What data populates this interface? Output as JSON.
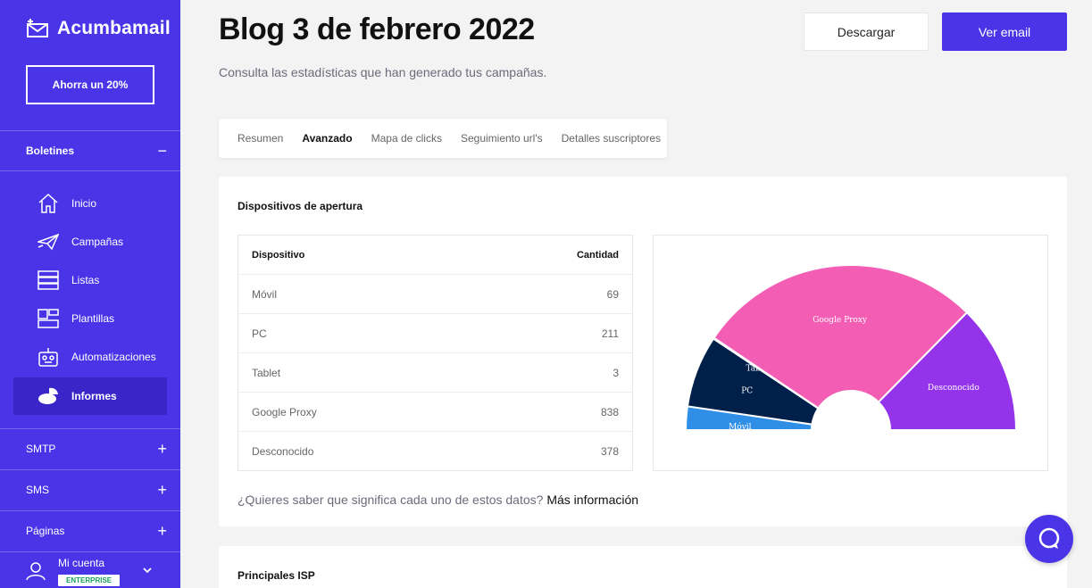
{
  "brand": {
    "name": "Acumbamail",
    "promo_label": "Ahorra un 20%"
  },
  "sidebar": {
    "boletines_label": "Boletines",
    "items": [
      {
        "label": "Inicio",
        "icon": "home-icon"
      },
      {
        "label": "Campañas",
        "icon": "paper-plane-icon"
      },
      {
        "label": "Listas",
        "icon": "list-icon"
      },
      {
        "label": "Plantillas",
        "icon": "template-icon"
      },
      {
        "label": "Automatizaciones",
        "icon": "robot-icon"
      },
      {
        "label": "Informes",
        "icon": "report-icon",
        "active": true
      }
    ],
    "sections": [
      {
        "label": "SMTP"
      },
      {
        "label": "SMS"
      },
      {
        "label": "Páginas"
      }
    ],
    "account": {
      "label": "Mi cuenta",
      "plan": "ENTERPRISE"
    }
  },
  "header": {
    "title": "Blog 3 de febrero 2022",
    "subtitle": "Consulta las estadísticas que han generado tus campañas.",
    "download_label": "Descargar",
    "view_email_label": "Ver email"
  },
  "tabs": [
    {
      "label": "Resumen"
    },
    {
      "label": "Avanzado",
      "active": true
    },
    {
      "label": "Mapa de clicks"
    },
    {
      "label": "Seguimiento url's"
    },
    {
      "label": "Detalles suscriptores"
    }
  ],
  "devices": {
    "title": "Dispositivos de apertura",
    "col_device": "Dispositivo",
    "col_count": "Cantidad",
    "rows": [
      {
        "device": "Móvil",
        "count": "69"
      },
      {
        "device": "PC",
        "count": "211"
      },
      {
        "device": "Tablet",
        "count": "3"
      },
      {
        "device": "Google Proxy",
        "count": "838"
      },
      {
        "device": "Desconocido",
        "count": "378"
      }
    ],
    "info_question": "¿Quieres saber que significa cada uno de estos datos?",
    "info_link": "Más información"
  },
  "isp": {
    "title": "Principales ISP"
  },
  "colors": {
    "accent": "#4a34e8",
    "movil": "#2f8ee6",
    "pc": "#00204a",
    "tablet": "#00204a",
    "google_proxy": "#f35db4",
    "desconocido": "#9333ea"
  },
  "chart_data": {
    "type": "pie",
    "style": "half-donut",
    "labels": [
      "Móvil",
      "PC",
      "Tablet",
      "Google Proxy",
      "Desconocido"
    ],
    "values": [
      69,
      211,
      3,
      838,
      378
    ],
    "colors": [
      "#2f8ee6",
      "#00204a",
      "#00204a",
      "#f35db4",
      "#9333ea"
    ]
  }
}
